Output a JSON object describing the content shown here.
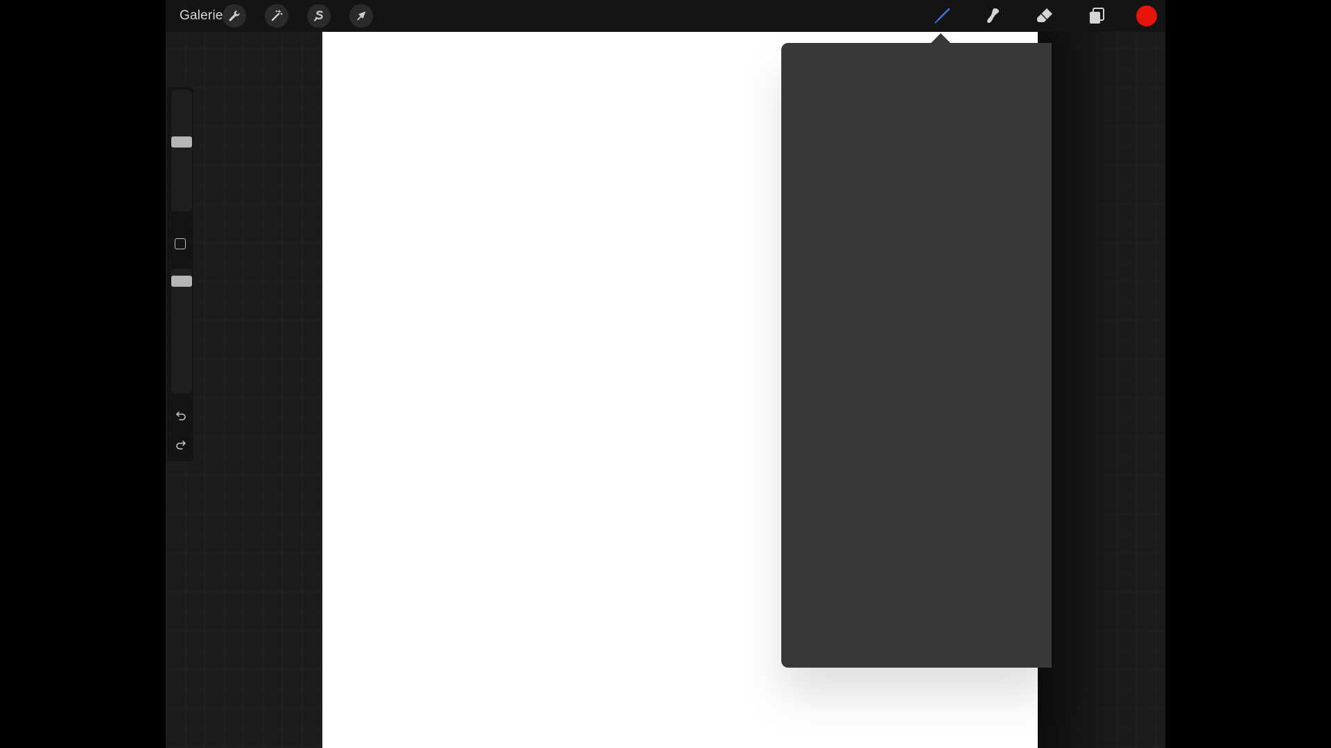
{
  "topbar": {
    "gallery_label": "Galerie",
    "left_tools": [
      {
        "name": "actions",
        "icon": "wrench-icon"
      },
      {
        "name": "adjustments",
        "icon": "magic-wand-icon"
      },
      {
        "name": "selection",
        "icon": "selection-s-icon"
      },
      {
        "name": "transform",
        "icon": "arrow-cursor-icon"
      }
    ],
    "right_tools": [
      {
        "name": "brush",
        "icon": "brush-icon",
        "active": true
      },
      {
        "name": "smudge",
        "icon": "smudge-icon"
      },
      {
        "name": "eraser",
        "icon": "eraser-icon"
      },
      {
        "name": "layers",
        "icon": "layers-icon"
      },
      {
        "name": "color",
        "icon": "color-swatch"
      }
    ],
    "active_color": "#e8140c",
    "brush_accent": "#3b7bd4"
  },
  "sidebar": {
    "brush_size_level": 0.58,
    "opacity_level": 0.94
  },
  "canvas": {
    "background": "#ffffff"
  },
  "popover": {
    "background": "#38383a"
  }
}
